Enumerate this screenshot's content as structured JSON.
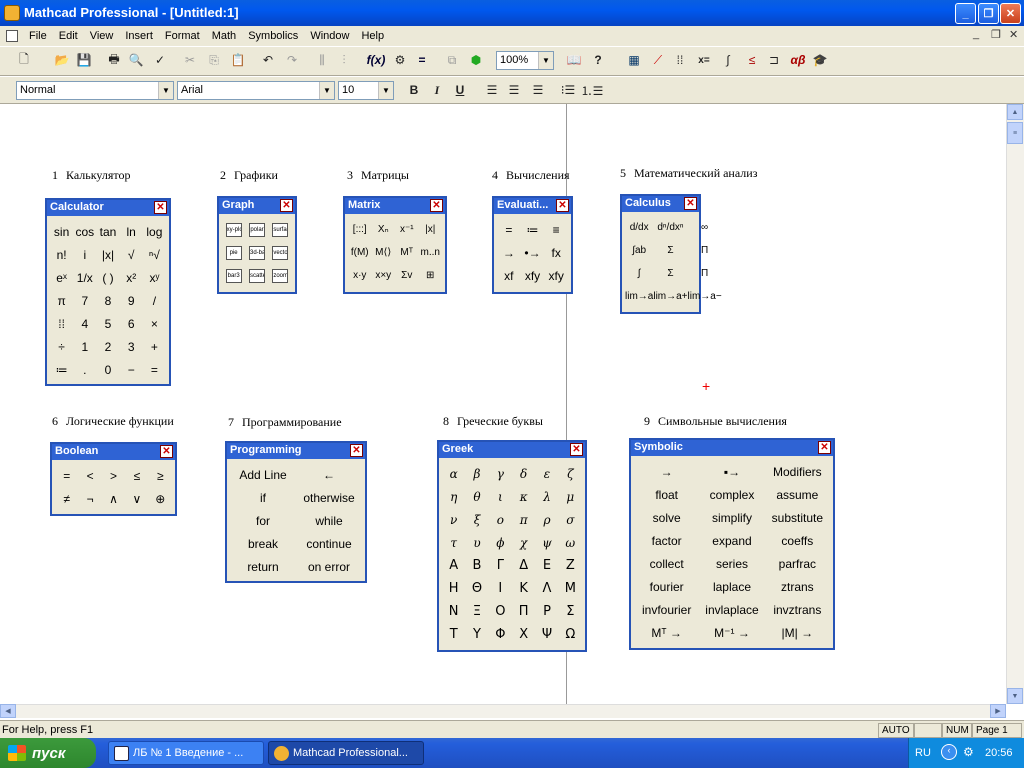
{
  "window": {
    "title": "Mathcad Professional - [Untitled:1]"
  },
  "menu": [
    "File",
    "Edit",
    "View",
    "Insert",
    "Format",
    "Math",
    "Symbolics",
    "Window",
    "Help"
  ],
  "toolbar": {
    "zoom": "100%"
  },
  "format": {
    "style": "Normal",
    "font": "Arial",
    "size": "10",
    "bold": "B",
    "italic": "I",
    "underline": "U"
  },
  "captions": [
    {
      "n": "1",
      "label": "Калькулятор"
    },
    {
      "n": "2",
      "label": "Графики"
    },
    {
      "n": "3",
      "label": "Матрицы"
    },
    {
      "n": "4",
      "label": "Вычисления"
    },
    {
      "n": "5",
      "label": "Математический анализ"
    },
    {
      "n": "6",
      "label": "Логические функции"
    },
    {
      "n": "7",
      "label": "Программирование"
    },
    {
      "n": "8",
      "label": "Греческие буквы"
    },
    {
      "n": "9",
      "label": "Символьные вычисления"
    }
  ],
  "palettes": {
    "calculator": {
      "title": "Calculator",
      "cells": [
        "sin",
        "cos",
        "tan",
        "ln",
        "log",
        "n!",
        "i",
        "|x|",
        "√",
        "ⁿ√",
        "eˣ",
        "1/x",
        "( )",
        "x²",
        "xʸ",
        "π",
        "7",
        "8",
        "9",
        "/",
        "⁞⁞",
        "4",
        "5",
        "6",
        "×",
        "÷",
        "1",
        "2",
        "3",
        "+",
        "≔",
        ".",
        "0",
        "−",
        "="
      ]
    },
    "graph": {
      "title": "Graph",
      "cells": [
        "xy-plot",
        "polar",
        "surface",
        "pie",
        "3d-bar",
        "vector",
        "bar3",
        "scatter",
        "zoom"
      ]
    },
    "matrix": {
      "title": "Matrix",
      "cells": [
        "[:::]",
        "Xₙ",
        "x⁻¹",
        "|x|",
        "f(M)",
        "M⟨⟩",
        "Mᵀ",
        "m..n",
        "x·y",
        "x×y",
        "Σv",
        "⊞"
      ]
    },
    "evaluation": {
      "title": "Evaluati...",
      "cells": [
        "=",
        "≔",
        "≡",
        "→",
        "•→",
        "fx",
        "xf",
        "xfy",
        "xfy"
      ]
    },
    "calculus": {
      "title": "Calculus",
      "cells": [
        "d/dx",
        "dⁿ/dxⁿ",
        "∞",
        "∫ab",
        "Σ",
        "Π",
        "∫",
        "Σ",
        "Π",
        "lim→a",
        "lim→a+",
        "lim→a−"
      ]
    },
    "boolean": {
      "title": "Boolean",
      "cells": [
        "=",
        "<",
        ">",
        "≤",
        "≥",
        "≠",
        "¬",
        "∧",
        "∨",
        "⊕"
      ]
    },
    "programming": {
      "title": "Programming",
      "cells": [
        "Add Line",
        "←",
        "if",
        "otherwise",
        "for",
        "while",
        "break",
        "continue",
        "return",
        "on error"
      ]
    },
    "greek": {
      "title": "Greek",
      "lower": [
        "α",
        "β",
        "γ",
        "δ",
        "ε",
        "ζ",
        "η",
        "θ",
        "ι",
        "κ",
        "λ",
        "μ",
        "ν",
        "ξ",
        "ο",
        "π",
        "ρ",
        "σ",
        "τ",
        "υ",
        "ϕ",
        "χ",
        "ψ",
        "ω"
      ],
      "upper": [
        "Α",
        "Β",
        "Γ",
        "Δ",
        "Ε",
        "Ζ",
        "Η",
        "Θ",
        "Ι",
        "Κ",
        "Λ",
        "Μ",
        "Ν",
        "Ξ",
        "Ο",
        "Π",
        "Ρ",
        "Σ",
        "Τ",
        "Υ",
        "Φ",
        "Χ",
        "Ψ",
        "Ω"
      ]
    },
    "symbolic": {
      "title": "Symbolic",
      "cells": [
        "→",
        "▪→",
        "Modifiers",
        "float",
        "complex",
        "assume",
        "solve",
        "simplify",
        "substitute",
        "factor",
        "expand",
        "coeffs",
        "collect",
        "series",
        "parfrac",
        "fourier",
        "laplace",
        "ztrans",
        "invfourier",
        "invlaplace",
        "invztrans",
        "Mᵀ →",
        "M⁻¹ →",
        "|M| →"
      ]
    }
  },
  "status": {
    "help": "For Help, press F1",
    "auto": "AUTO",
    "num": "NUM",
    "page": "Page 1"
  },
  "taskbar": {
    "start": "пуск",
    "tasks": [
      "ЛБ № 1 Введение - ...",
      "Mathcad Professional..."
    ],
    "lang": "RU",
    "clock": "20:56"
  }
}
